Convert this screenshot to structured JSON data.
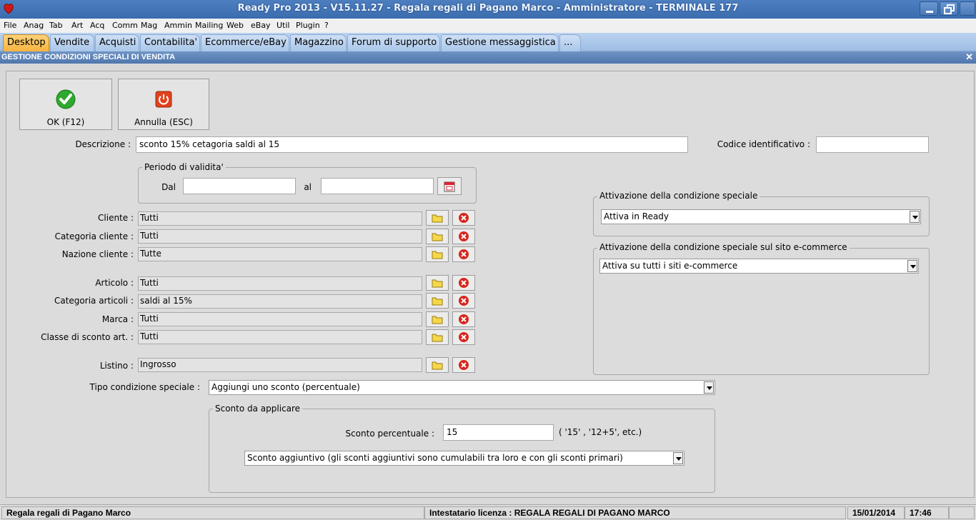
{
  "window": {
    "title": "Ready Pro 2013 - V15.11.27 - Regala regali di Pagano Marco - Amministratore - TERMINALE 177"
  },
  "menu": [
    "File",
    "Anag",
    "Tab",
    "Art",
    "Acq",
    "Comm",
    "Mag",
    "Ammin",
    "Mailing",
    "Web",
    "eBay",
    "Util",
    "Plugin",
    "?"
  ],
  "tabs": [
    "Desktop",
    "Vendite",
    "Acquisti",
    "Contabilita'",
    "Ecommerce/eBay",
    "Magazzino",
    "Forum di supporto",
    "Gestione messaggistica",
    "..."
  ],
  "section_title": "GESTIONE CONDIZIONI SPECIALI DI VENDITA",
  "buttons": {
    "ok": "OK (F12)",
    "cancel": "Annulla (ESC)"
  },
  "form": {
    "descrizione_label": "Descrizione :",
    "descrizione_value": "sconto 15% cetagoria saldi al 15",
    "codice_label": "Codice identificativo :",
    "codice_value": "",
    "periodo_title": "Periodo di validita'",
    "dal_label": "Dal",
    "dal_value": "",
    "al_label": "al",
    "al_value": "",
    "cliente_label": "Cliente :",
    "cliente_value": "Tutti",
    "categoria_cliente_label": "Categoria cliente :",
    "categoria_cliente_value": "Tutti",
    "nazione_cliente_label": "Nazione cliente :",
    "nazione_cliente_value": "Tutte",
    "articolo_label": "Articolo :",
    "articolo_value": "Tutti",
    "categoria_articoli_label": "Categoria articoli :",
    "categoria_articoli_value": "saldi al 15%",
    "marca_label": "Marca :",
    "marca_value": "Tutti",
    "classe_sconto_label": "Classe di sconto art. :",
    "classe_sconto_value": "Tutti",
    "listino_label": "Listino :",
    "listino_value": "Ingrosso",
    "tipo_label": "Tipo condizione speciale :",
    "tipo_value": "Aggiungi uno sconto (percentuale)",
    "sconto_title": "Sconto da applicare",
    "sconto_perc_label": "Sconto percentuale :",
    "sconto_perc_value": "15",
    "sconto_hint": "( '15' ,  '12+5', etc.)",
    "sconto_tipo_value": "Sconto aggiuntivo (gli sconti aggiuntivi sono cumulabili tra loro e con gli sconti primari)"
  },
  "attivazione": {
    "title": "Attivazione della condizione speciale",
    "value": "Attiva in Ready",
    "web_title": "Attivazione della condizione speciale sul sito e-commerce",
    "web_value": "Attiva su tutti i siti e-commerce"
  },
  "status": {
    "company": "Regala regali di Pagano Marco",
    "license": "Intestatario licenza : REGALA REGALI DI PAGANO MARCO",
    "date": "15/01/2014",
    "time": "17:46"
  }
}
